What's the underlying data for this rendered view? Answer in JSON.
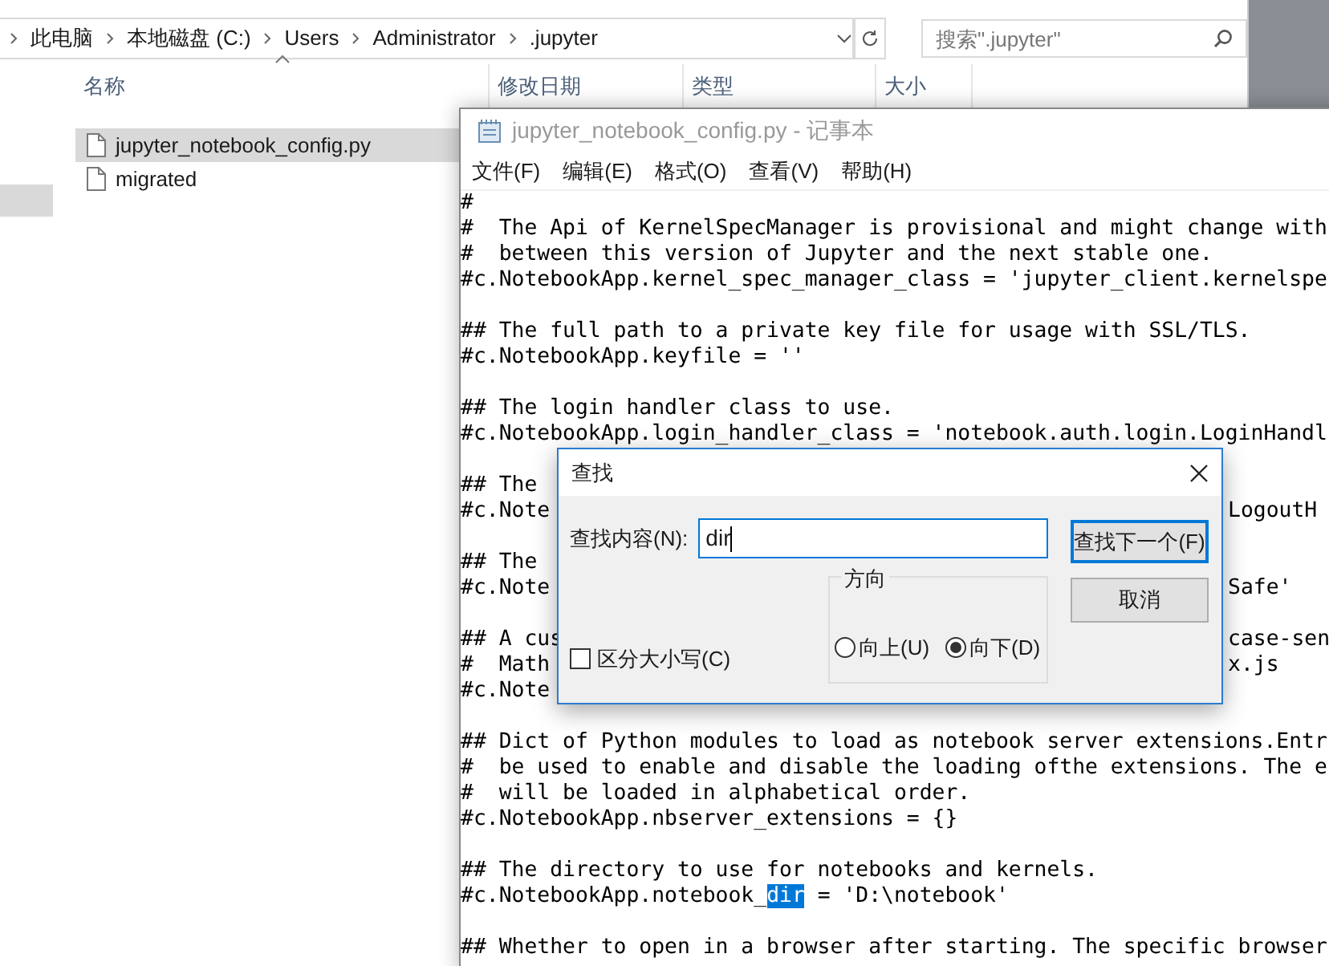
{
  "explorer": {
    "breadcrumb": [
      "此电脑",
      "本地磁盘 (C:)",
      "Users",
      "Administrator",
      ".jupyter"
    ],
    "search": {
      "placeholder": "搜索\".jupyter\""
    },
    "columns": [
      "名称",
      "修改日期",
      "类型",
      "大小"
    ],
    "files": [
      {
        "name": "jupyter_notebook_config.py",
        "selected": true
      },
      {
        "name": "migrated",
        "selected": false
      }
    ]
  },
  "notepad": {
    "title": "jupyter_notebook_config.py - 记事本",
    "menu": [
      "文件(F)",
      "编辑(E)",
      "格式(O)",
      "查看(V)",
      "帮助(H)"
    ],
    "paragraphs": [
      {
        "lines": [
          {
            "left": "#"
          },
          {
            "left": "#  The Api of KernelSpecManager is provisional and might change with"
          },
          {
            "left": "#  between this version of Jupyter and the next stable one."
          },
          {
            "left": "#c.NotebookApp.kernel_spec_manager_class = 'jupyter_client.kernelspe"
          }
        ]
      },
      {
        "lines": [
          {
            "left": "## The full path to a private key file for usage with SSL/TLS."
          },
          {
            "left": "#c.NotebookApp.keyfile = ''"
          }
        ]
      },
      {
        "lines": [
          {
            "left": "## The login handler class to use."
          },
          {
            "left": "#c.NotebookApp.login_handler_class = 'notebook.auth.login.LoginHandl"
          }
        ]
      },
      {
        "lines": [
          {
            "left": "## The"
          },
          {
            "left": "#c.Note",
            "right": "LogoutH"
          }
        ]
      },
      {
        "lines": [
          {
            "left": "## The"
          },
          {
            "left": "#c.Note",
            "right": "Safe'"
          }
        ]
      },
      {
        "lines": [
          {
            "left": "## A cus",
            "right": "case-sen"
          },
          {
            "left": "#  Math",
            "right": "x.js"
          },
          {
            "left": "#c.Note"
          }
        ]
      },
      {
        "lines": [
          {
            "left": "## Dict of Python modules to load as notebook server extensions.Entr"
          },
          {
            "left": "#  be used to enable and disable the loading ofthe extensions. The e"
          },
          {
            "left": "#  will be loaded in alphabetical order."
          },
          {
            "left": "#c.NotebookApp.nbserver_extensions = {}"
          }
        ]
      },
      {
        "lines": [
          {
            "left": "## The directory to use for notebooks and kernels."
          },
          {
            "segments": [
              {
                "text": "#c.NotebookApp.notebook_",
                "selected": false
              },
              {
                "text": "dir",
                "selected": true
              },
              {
                "text": " = 'D:\\notebook'",
                "selected": false
              }
            ]
          }
        ]
      },
      {
        "lines": [
          {
            "left": "## Whether to open in a browser after starting. The specific browser"
          }
        ]
      }
    ]
  },
  "find_dialog": {
    "title": "查找",
    "find_label": "查找内容(N):",
    "find_value": "dir",
    "find_next_button": "查找下一个(F)",
    "cancel_button": "取消",
    "match_case": {
      "label": "区分大小写(C)",
      "checked": false
    },
    "direction": {
      "label": "方向",
      "options": [
        {
          "label": "向上(U)",
          "selected": false
        },
        {
          "label": "向下(D)",
          "selected": true
        }
      ]
    }
  }
}
